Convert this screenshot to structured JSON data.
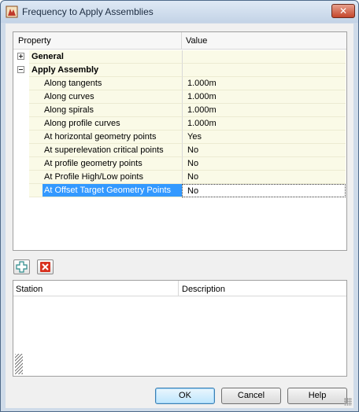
{
  "window": {
    "title": "Frequency to Apply Assemblies",
    "close_label": "✕"
  },
  "grid": {
    "header_property": "Property",
    "header_value": "Value",
    "categories": [
      {
        "name": "General",
        "expander": "+"
      },
      {
        "name": "Apply Assembly",
        "expander": "−"
      }
    ],
    "properties": [
      {
        "name": "Along tangents",
        "value": "1.000m"
      },
      {
        "name": "Along curves",
        "value": "1.000m"
      },
      {
        "name": "Along spirals",
        "value": "1.000m"
      },
      {
        "name": "Along profile curves",
        "value": "1.000m"
      },
      {
        "name": "At horizontal geometry points",
        "value": "Yes"
      },
      {
        "name": "At superelevation critical points",
        "value": "No"
      },
      {
        "name": "At profile geometry points",
        "value": "No"
      },
      {
        "name": "At Profile High/Low points",
        "value": "No"
      },
      {
        "name": "At Offset Target Geometry Points",
        "value": "No"
      }
    ]
  },
  "toolbar": {
    "add_icon": "add-icon",
    "delete_icon": "delete-icon"
  },
  "station_list": {
    "header_station": "Station",
    "header_description": "Description"
  },
  "buttons": {
    "ok": "OK",
    "cancel": "Cancel",
    "help": "Help"
  },
  "colors": {
    "selection": "#3399ff",
    "row_bg": "#fafae7",
    "delete_red": "#d8321f",
    "add_teal": "#2a8a8a"
  }
}
